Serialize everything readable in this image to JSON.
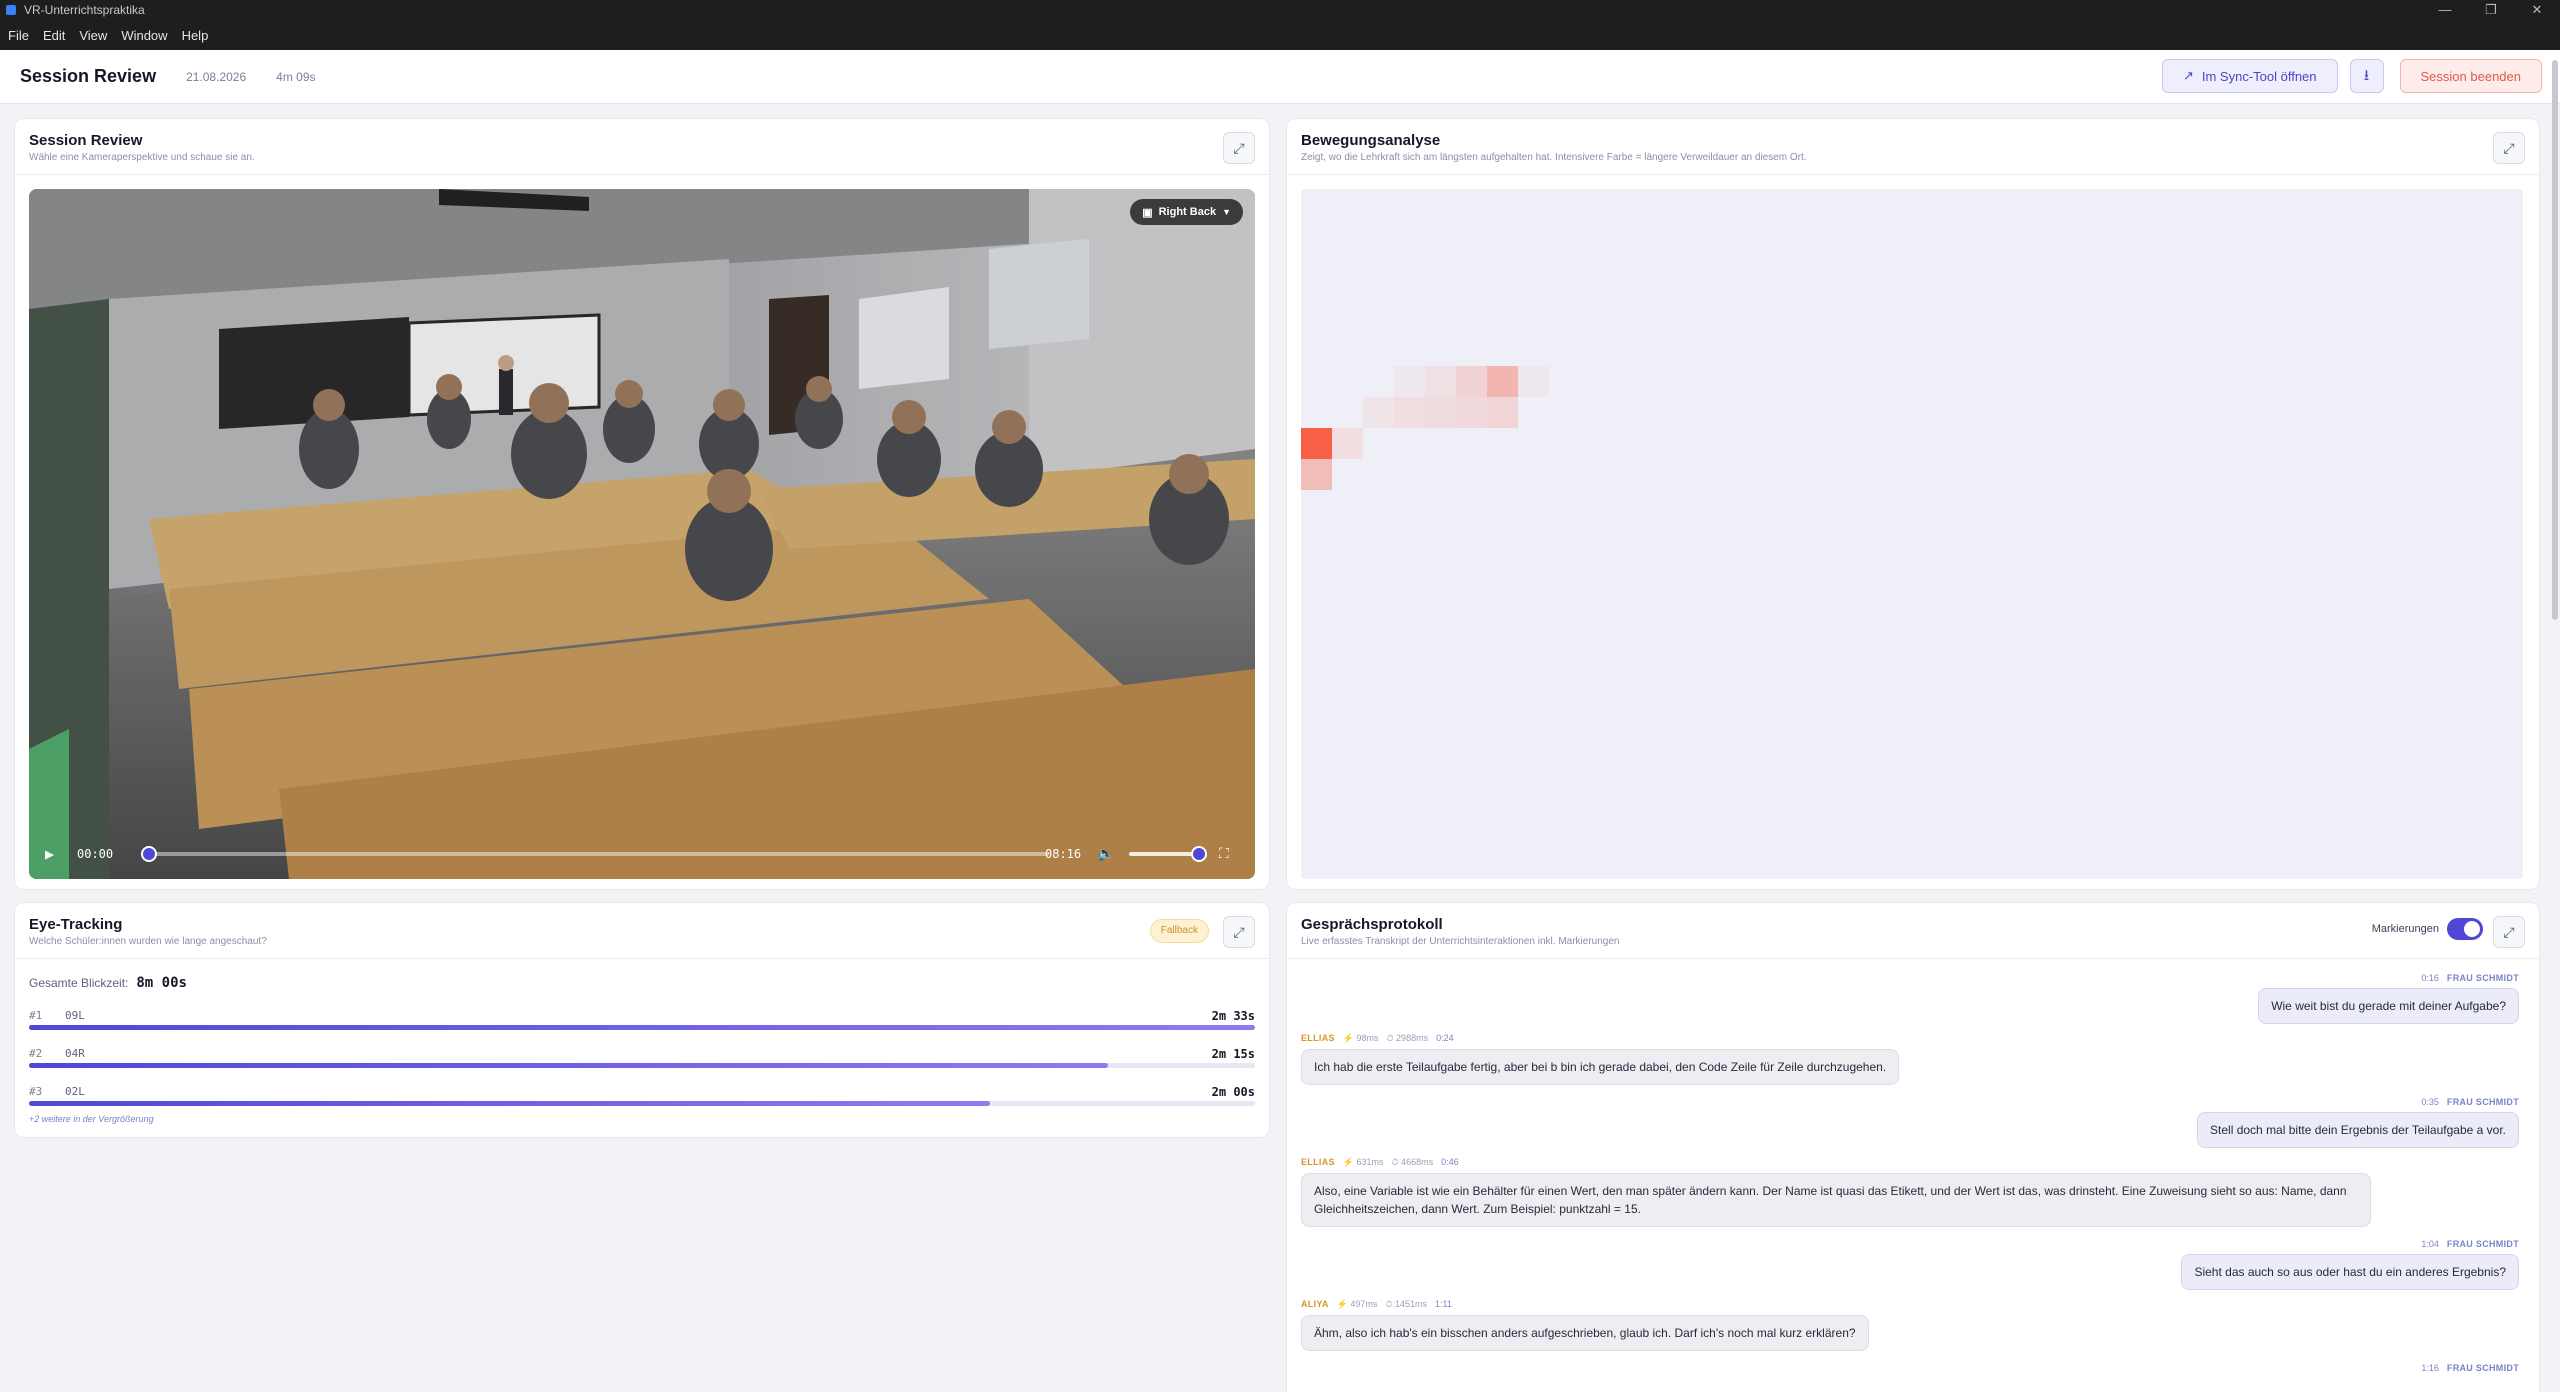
{
  "window": {
    "title": "VR-Unterrichtspraktika",
    "controls": [
      "—",
      "❐",
      "✕"
    ]
  },
  "menu": [
    "File",
    "Edit",
    "View",
    "Window",
    "Help"
  ],
  "header": {
    "title": "Session Review",
    "date": "21.08.2026",
    "duration": "4m 09s",
    "sync_label": "Im Sync-Tool öffnen",
    "end_label": "Session beenden"
  },
  "video_panel": {
    "title": "Session Review",
    "subtitle": "Wähle eine Kameraperspektive und schaue sie an.",
    "camera": "Right Back",
    "current_time": "00:00",
    "total_time": "08:16",
    "progress": 0.0,
    "volume": 1.0
  },
  "heat_panel": {
    "title": "Bewegungsanalyse",
    "subtitle": "Zeigt, wo die Lehrkraft sich am längsten aufgehalten hat. Intensivere Farbe = längere Verweildauer an diesem Ort.",
    "cells": [
      {
        "col": 0,
        "row": 5,
        "intensity": 1.0
      },
      {
        "col": 1,
        "row": 5,
        "intensity": 0.12
      },
      {
        "col": 0,
        "row": 6,
        "intensity": 0.35
      },
      {
        "col": 2,
        "row": 4,
        "intensity": 0.08
      },
      {
        "col": 3,
        "row": 4,
        "intensity": 0.12
      },
      {
        "col": 4,
        "row": 4,
        "intensity": 0.14
      },
      {
        "col": 5,
        "row": 4,
        "intensity": 0.15
      },
      {
        "col": 6,
        "row": 4,
        "intensity": 0.18
      },
      {
        "col": 4,
        "row": 3,
        "intensity": 0.1
      },
      {
        "col": 5,
        "row": 3,
        "intensity": 0.2
      },
      {
        "col": 6,
        "row": 3,
        "intensity": 0.4
      },
      {
        "col": 7,
        "row": 3,
        "intensity": 0.05
      },
      {
        "col": 3,
        "row": 3,
        "intensity": 0.05
      }
    ],
    "accent": "#f76045"
  },
  "eye_panel": {
    "title": "Eye-Tracking",
    "subtitle": "Welche Schüler:innen wurden wie lange angeschaut?",
    "badge": "Fallback",
    "total_label": "Gesamte Blickzeit:",
    "total_value": "8m 00s",
    "rows": [
      {
        "rank": "#1",
        "name": "09L",
        "time": "2m 33s",
        "share": 1.0
      },
      {
        "rank": "#2",
        "name": "04R",
        "time": "2m 15s",
        "share": 0.88
      },
      {
        "rank": "#3",
        "name": "02L",
        "time": "2m 00s",
        "share": 0.784
      }
    ],
    "more": "+2 weitere in der Vergrößerung"
  },
  "transcript_panel": {
    "title": "Gesprächsprotokoll",
    "subtitle": "Live erfasstes Transkript der Unterrichtsinteraktionen inkl. Markierungen",
    "marks_label": "Markierungen",
    "messages": [
      {
        "side": "right",
        "time": "0:16",
        "speaker": "FRAU SCHMIDT",
        "text": "Wie weit bist du gerade mit deiner Aufgabe?"
      },
      {
        "side": "left",
        "speaker": "ELLIAS",
        "s1": "⚡ 98ms",
        "s2": "⏱ 2988ms",
        "time": "0:24",
        "text": "Ich hab die erste Teilaufgabe fertig, aber bei b bin ich gerade dabei, den Code Zeile für Zeile durchzugehen."
      },
      {
        "side": "right",
        "time": "0:35",
        "speaker": "FRAU SCHMIDT",
        "text": "Stell doch mal bitte dein Ergebnis der Teilaufgabe a vor."
      },
      {
        "side": "left",
        "speaker": "ELLIAS",
        "s1": "⚡ 631ms",
        "s2": "⏱ 4668ms",
        "time": "0:46",
        "text": "Also, eine Variable ist wie ein Behälter für einen Wert, den man später ändern kann. Der Name ist quasi das Etikett, und der Wert ist das, was drinsteht. Eine Zuweisung sieht so aus: Name, dann Gleichheitszeichen, dann Wert. Zum Beispiel: punktzahl = 15."
      },
      {
        "side": "right",
        "time": "1:04",
        "speaker": "FRAU SCHMIDT",
        "text": "Sieht das auch so aus oder hast du ein anderes Ergebnis?"
      },
      {
        "side": "left",
        "speaker": "ALIYA",
        "s1": "⚡ 497ms",
        "s2": "⏱ 1451ms",
        "time": "1:11",
        "text": "Ähm, also ich hab's ein bisschen anders aufgeschrieben, glaub ich. Darf ich's noch mal kurz erklären?"
      },
      {
        "side": "right",
        "time": "1:16",
        "speaker": "FRAU SCHMIDT",
        "text": ""
      }
    ]
  }
}
